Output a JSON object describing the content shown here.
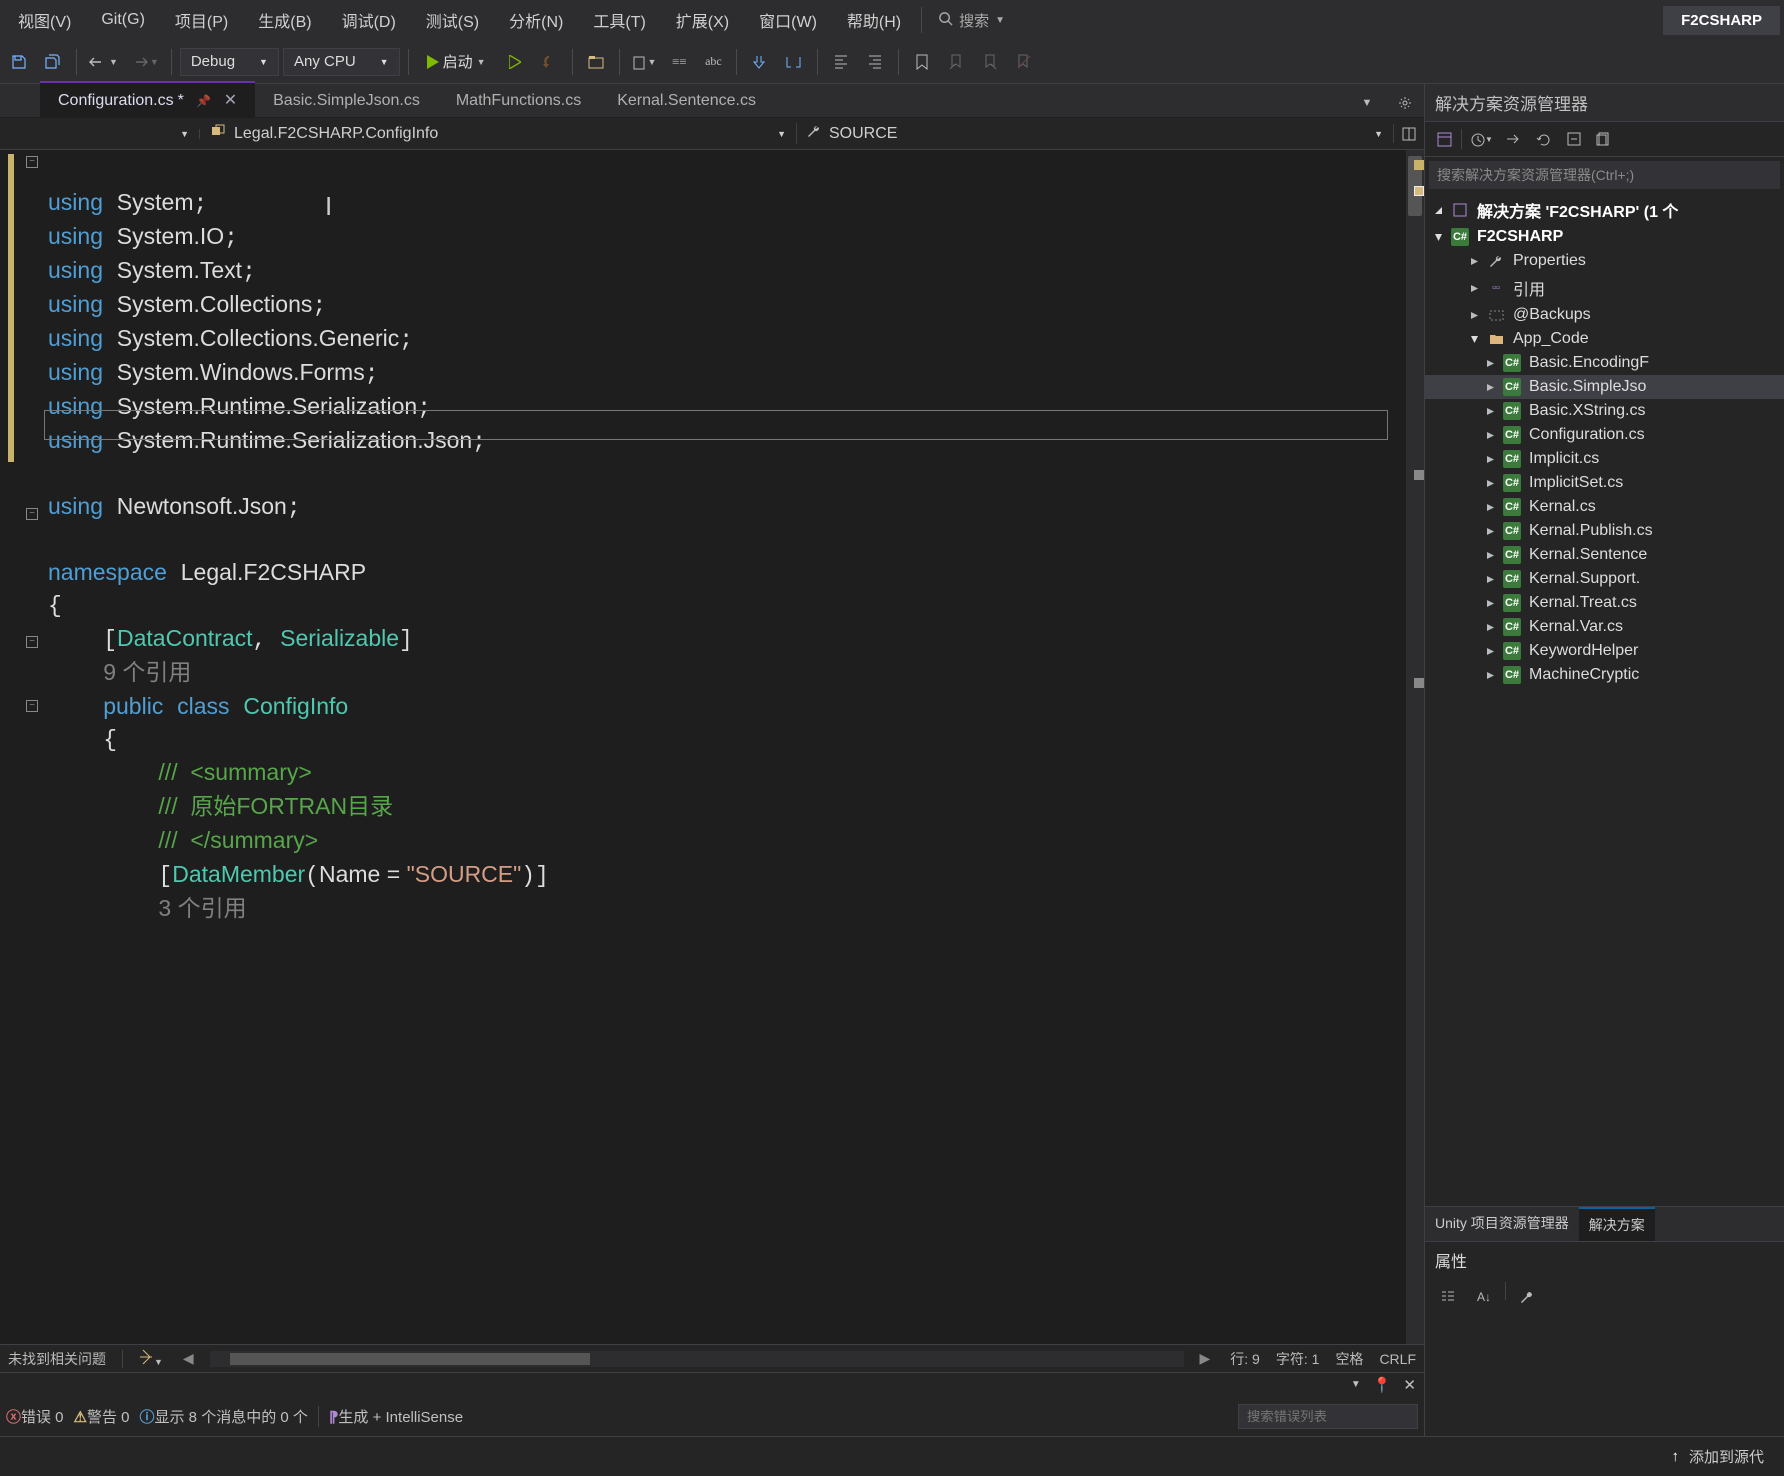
{
  "menubar": {
    "items": [
      "视图(V)",
      "Git(G)",
      "项目(P)",
      "生成(B)",
      "调试(D)",
      "测试(S)",
      "分析(N)",
      "工具(T)",
      "扩展(X)",
      "窗口(W)",
      "帮助(H)"
    ],
    "search_label": "搜索",
    "brand": "F2CSHARP"
  },
  "toolbar": {
    "config_dropdown": "Debug",
    "platform_dropdown": "Any CPU",
    "start_label": "启动"
  },
  "tabs": [
    {
      "label": "Configuration.cs",
      "dirty": "*",
      "active": true,
      "pinned": true
    },
    {
      "label": "Basic.SimpleJson.cs",
      "active": false
    },
    {
      "label": "MathFunctions.cs",
      "active": false
    },
    {
      "label": "Kernal.Sentence.cs",
      "active": false
    }
  ],
  "navbar": {
    "seg1": "",
    "seg2": "Legal.F2CSHARP.ConfigInfo",
    "seg3": "SOURCE"
  },
  "code": {
    "kw_using": "using",
    "kw_namespace": "namespace",
    "kw_public": "public",
    "kw_class": "class",
    "l1_ns": "System",
    "l2_ns": "System.IO",
    "l3_ns": "System.Text",
    "l4_ns": "System.Collections",
    "l5_ns": "System.Collections.Generic",
    "l6_ns": "System.Windows.Forms",
    "l7_ns": "System.Runtime.Serialization",
    "l8_ns": "System.Runtime.Serialization.Json",
    "l10_ns": "Newtonsoft.Json",
    "ns_name": "Legal.F2CSHARP",
    "attr1": "DataContract",
    "attr2": "Serializable",
    "ref_count1": "9 个引用",
    "class_name": "ConfigInfo",
    "cmt1": "///  <summary>",
    "cmt2": "///  原始FORTRAN目录",
    "cmt3": "///  </summary>",
    "dm_attr": "DataMember",
    "dm_arg": "Name = ",
    "dm_str": "\"SOURCE\"",
    "ref_count2": "3 个引用"
  },
  "status": {
    "left": "未找到相关问题",
    "line_label": "行: 9",
    "col_label": "字符: 1",
    "spaces": "空格",
    "eol": "CRLF"
  },
  "solution": {
    "panel_title": "解决方案资源管理器",
    "search_placeholder": "搜索解决方案资源管理器(Ctrl+;)",
    "root": "解决方案 'F2CSHARP' (1 个",
    "project": "F2CSHARP",
    "properties": "Properties",
    "refs": "引用",
    "backups": "@Backups",
    "app_code": "App_Code",
    "files": [
      "Basic.EncodingF",
      "Basic.SimpleJso",
      "Basic.XString.cs",
      "Configuration.cs",
      "Implicit.cs",
      "ImplicitSet.cs",
      "Kernal.cs",
      "Kernal.Publish.cs",
      "Kernal.Sentence",
      "Kernal.Support.",
      "Kernal.Treat.cs",
      "Kernal.Var.cs",
      "KeywordHelper",
      "MachineCryptic"
    ]
  },
  "bottom_tabs": {
    "unity": "Unity 项目资源管理器",
    "soln": "解决方案"
  },
  "props": {
    "title": "属性"
  },
  "errorlist": {
    "err_label": "错误 0",
    "warn_label": "警告 0",
    "info_label": "显示 8 个消息中的 0 个",
    "build_label": "生成 + IntelliSense",
    "search_placeholder": "搜索错误列表"
  },
  "footer": {
    "add_source": "添加到源代"
  }
}
